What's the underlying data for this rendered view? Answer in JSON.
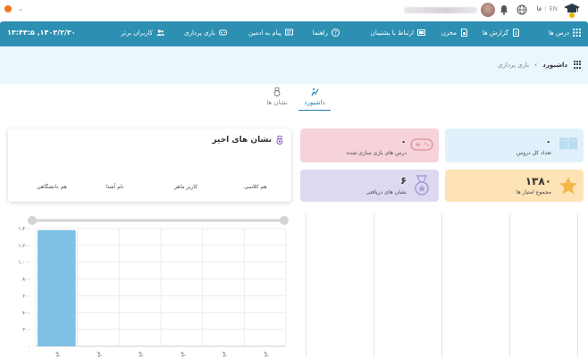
{
  "header": {
    "lang_en": "EN",
    "lang_fa": "فا",
    "lang_separator": "|"
  },
  "nav": {
    "items": [
      {
        "label": "درس ها",
        "icon": "grid-icon"
      },
      {
        "label": "گزارش ها",
        "icon": "report-icon"
      },
      {
        "label": "مخزن",
        "icon": "repository-icon"
      },
      {
        "label": "ارتباط با پشتیبان",
        "icon": "support-icon"
      },
      {
        "label": "راهنما",
        "icon": "help-icon"
      },
      {
        "label": "پیام به ادمین",
        "icon": "message-icon"
      },
      {
        "label": "بازی پردازی",
        "icon": "gamepad-icon"
      },
      {
        "label": "کاربران برتر",
        "icon": "users-icon"
      }
    ],
    "datetime": "۱۳:۴۳:۵ ,۱۴۰۳/۲/۳۰"
  },
  "breadcrumb": {
    "home": "داشبورد",
    "separator": "›",
    "current": "بازی پردازی"
  },
  "tabs": [
    {
      "label": "داشبورد",
      "active": true
    },
    {
      "label": "نشان ها",
      "active": false
    }
  ],
  "stats": {
    "total_courses": {
      "value": "۰",
      "label": "تعداد کل دروس"
    },
    "gamified_courses": {
      "value": "۰",
      "label": "درس های بازی سازی شده"
    },
    "total_points": {
      "value": "۱۳۸۰",
      "label": "مجموع امتیاز ها"
    },
    "badges_received": {
      "value": "۶",
      "label": "نشان های دریافتی"
    }
  },
  "recent_badges": {
    "title": "نشان های اخیر",
    "items": [
      "هم کلاسی",
      "کاربر ماهر",
      "نام آشنا",
      "هم دانشگاهی"
    ]
  },
  "colors": {
    "nav_bg": "#2d8fb2",
    "band_bg": "#eaf7fd",
    "card_blue": "#e1f1fb",
    "card_pink": "#f6d3d8",
    "card_orange": "#fde3b6",
    "card_purple": "#dcd9f1",
    "bar": "#7fc1e6"
  },
  "chart_data": {
    "type": "bar",
    "ylim": [
      0,
      1400
    ],
    "yticks": [
      "۰",
      "۲۰۰",
      "۴۰۰",
      "۶۰۰",
      "۸۰۰",
      "۱,۰۰۰",
      "۱,۲۰۰",
      "۱,۴۰۰"
    ],
    "categories": [
      "نام",
      "نام",
      "نام",
      "نام",
      "نام",
      "نام"
    ],
    "values": [
      1380,
      0,
      0,
      0,
      0,
      0
    ]
  }
}
